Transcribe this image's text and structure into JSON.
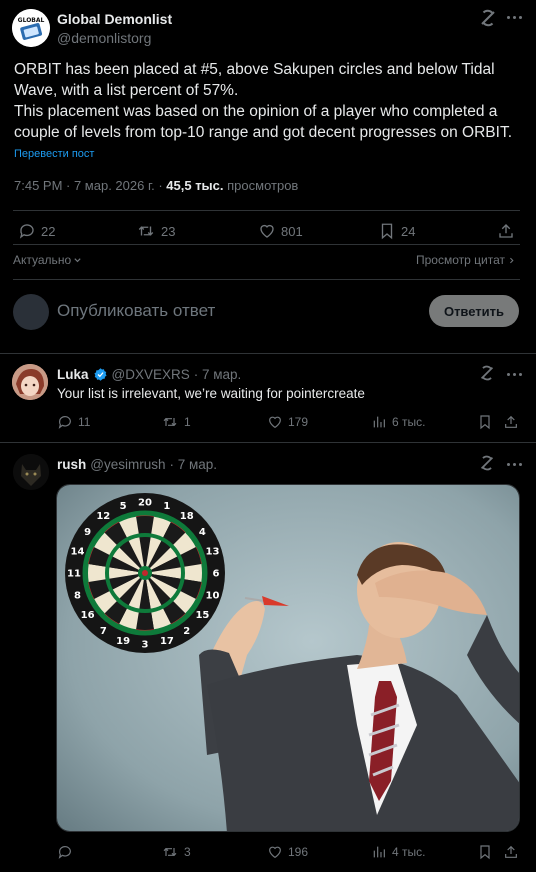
{
  "post": {
    "author_name": "Global Demonlist",
    "author_handle": "@demonlistorg",
    "text_line1": "ORBIT has been placed at #5, above Sakupen circles and below Tidal",
    "text_line2": "Wave, with a list percent of 57%.",
    "text_line3": "This placement was based on the opinion of a player who completed a",
    "text_line4": "couple of levels from top-10 range and got decent progresses on ORBIT.",
    "translate_link": "Перевести пост",
    "timestamp": "7:45 PM · 7 мар. 2026 г. · ",
    "views_count": "45,5 тыс.",
    "views_label": " просмотров",
    "replies": "22",
    "reposts": "23",
    "likes": "801",
    "bookmarks": "24",
    "avatar_logo_text": "GLOBAL"
  },
  "sort": {
    "label": "Актуально",
    "quotes_link": "Просмотр цитат"
  },
  "composer": {
    "placeholder": "Опубликовать ответ",
    "reply_button": "Ответить"
  },
  "replies": [
    {
      "name": "Luka",
      "handle": "@DXVEXRS",
      "time": "· 7 мар.",
      "text": "Your list is irrelevant, we’re waiting for pointercreate",
      "replies": "11",
      "reposts": "1",
      "likes": "179",
      "views": "6 тыс."
    },
    {
      "name": "rush",
      "handle": "@yesimrush",
      "time": "· 7 мар.",
      "text": "",
      "replies": "",
      "reposts": "3",
      "likes": "196",
      "views": "4 тыс."
    }
  ],
  "dartboard_numbers": [
    "20",
    "1",
    "18",
    "4",
    "13",
    "6",
    "10",
    "15",
    "2",
    "17",
    "3",
    "19",
    "7",
    "16",
    "8",
    "11",
    "14",
    "9",
    "12",
    "5"
  ],
  "colors": {
    "background": "#000000",
    "text": "#e7e9ea",
    "muted": "#71767b",
    "link": "#1d9bf0",
    "divider": "#2f3336",
    "button_bg": "#e7e9ea",
    "verified": "#1d9bf0"
  }
}
